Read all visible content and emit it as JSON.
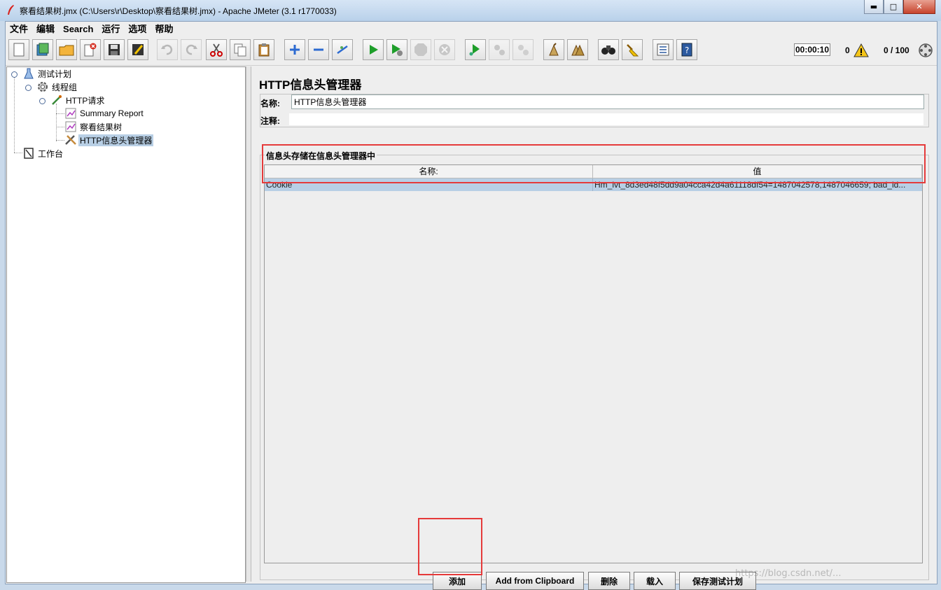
{
  "window": {
    "title": "察看结果树.jmx (C:\\Users\\r\\Desktop\\察看结果树.jmx) - Apache JMeter (3.1 r1770033)",
    "minimize": "▬",
    "maximize": "□",
    "close": "✕"
  },
  "menu": [
    "文件",
    "编辑",
    "Search",
    "运行",
    "选项",
    "帮助"
  ],
  "toolbar": {
    "timer": "00:00:10",
    "error_count": "0",
    "threads": "0 / 100",
    "buttons": [
      "new-icon",
      "templates-icon",
      "open-icon",
      "close-file-icon",
      "save-icon",
      "save-as-icon",
      "undo-icon",
      "redo-icon",
      "cut-icon",
      "copy-icon",
      "paste-icon",
      "expand-icon",
      "collapse-icon",
      "toggle-icon",
      "start-icon",
      "start-no-pause-icon",
      "stop-icon",
      "shutdown-icon",
      "remote-start-icon",
      "remote-stop-icon",
      "remote-shutdown-icon",
      "clear-icon",
      "clear-all-icon",
      "search-icon",
      "reset-search-icon",
      "function-helper-icon",
      "help-icon"
    ]
  },
  "tree": {
    "nodes": [
      {
        "label": "测试计划",
        "icon": "test-plan-icon"
      },
      {
        "label": "线程组",
        "icon": "thread-group-icon"
      },
      {
        "label": "HTTP请求",
        "icon": "sampler-icon"
      },
      {
        "label": "Summary Report",
        "icon": "listener-icon"
      },
      {
        "label": "察看结果树",
        "icon": "listener-icon"
      },
      {
        "label": "HTTP信息头管理器",
        "icon": "config-tool-icon",
        "selected": true
      },
      {
        "label": "工作台",
        "icon": "workbench-icon"
      }
    ]
  },
  "panel": {
    "title": "HTTP信息头管理器",
    "name_label": "名称:",
    "name_value": "HTTP信息头管理器",
    "comment_label": "注释:",
    "comment_value": "",
    "group_title": "信息头存储在信息头管理器中",
    "columns": [
      "名称:",
      "值"
    ],
    "rows": [
      {
        "name": "Cookie",
        "value": "Hm_lvt_8d3ed48f5dd9a04cca42d4a61118df54=1487042578,1487046659; bad_id..."
      }
    ],
    "buttons": {
      "add": "添加",
      "add_clipboard": "Add from Clipboard",
      "delete": "删除",
      "load": "载入",
      "save": "保存测试计划"
    }
  },
  "watermark": "https://blog.csdn.net/...",
  "colors": {
    "selection": "#b8cfe5",
    "highlight": "#e53a3a",
    "titlebar": "#c9dbee"
  }
}
